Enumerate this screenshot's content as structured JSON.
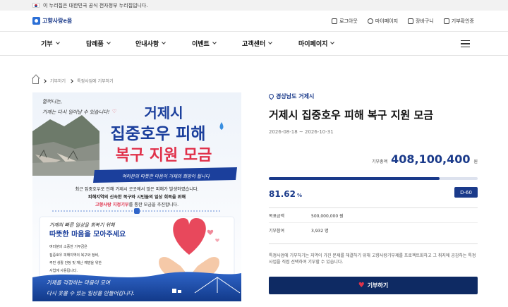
{
  "gov_banner": {
    "text": "이 누리집은 대한민국 공식 전자정부 누리집입니다."
  },
  "logo": {
    "text": "고향사랑e음"
  },
  "utils": [
    {
      "label": "로그아웃",
      "icon": "logout-icon"
    },
    {
      "label": "마이페이지",
      "icon": "user-icon"
    },
    {
      "label": "장바구니",
      "icon": "cart-icon"
    },
    {
      "label": "기부확인증",
      "icon": "certificate-icon"
    }
  ],
  "nav": [
    {
      "label": "기부"
    },
    {
      "label": "답례품"
    },
    {
      "label": "안내사항"
    },
    {
      "label": "이벤트"
    },
    {
      "label": "고객센터"
    },
    {
      "label": "마이페이지"
    }
  ],
  "breadcrumb": [
    "기부하기",
    "특정사업에 기부하기"
  ],
  "poster": {
    "top_note_1": "할머니는,",
    "top_note_2": "거제는 다시 일어날 수 있습니다!",
    "title_1": "거제시",
    "title_2": "집중호우 피해",
    "title_3": "복구 지원 모금",
    "ribbon": "여러분의 따뜻한 마음이 거제의 희망이 됩니다",
    "body_1": "최근 집중호우로 인해 거제시 곳곳에서 많은 피해가 발생하였습니다.",
    "body_2": "피해지역의 신속한 복구와 시민들의 일상 회복을 위해",
    "body_3_em": "고향사랑 지정기부",
    "body_3": "를 통한 모금을 추진합니다.",
    "card_1": "거제의 빠른 일상을 회복기 위해",
    "card_2": "따뜻한 마음을 모아주세요",
    "card_s1": "여러분의 소중한 기부금은",
    "card_s2": "집중호우 피해지역의 복구와 정비,",
    "card_s3": "주민 생활 안정 및 재난 예방을 위한",
    "card_s4": "사업에 사용됩니다.",
    "bottom_1": "거제를 걱정하는 마음이 모여",
    "bottom_2": "다시 웃을 수 있는 일상을 만들어갑니다."
  },
  "campaign": {
    "location": "경상남도 거제시",
    "title": "거제시 집중호우 피해 복구 지원 모금",
    "period": "2026-08-18 ~ 2026-10-31",
    "amount_label": "기부총액",
    "amount": "408,100,400",
    "amount_unit": "원",
    "progress": 0.8162,
    "percent": "81.62",
    "percent_unit": "%",
    "dday": "D-60",
    "goal_label": "목표금액",
    "goal": "500,000,000 원",
    "participants_label": "기부참여",
    "participants": "3,932 명",
    "description": "특정사업에 기부하기는 지역이 가진 문제를 해결하기 위해 고향사랑기부제를 프로젝트화하고 그 취지에 공감하는 특정사업을 직접 선택하여 기부할 수 있습니다.",
    "button": "기부하기"
  }
}
